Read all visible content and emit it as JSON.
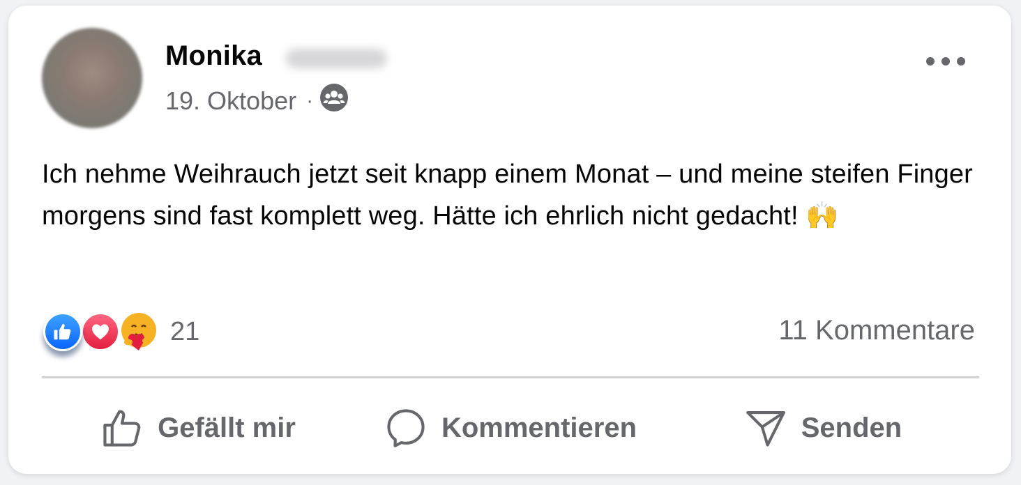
{
  "post": {
    "author_name": "Monika",
    "date": "19. Oktober",
    "separator": "·",
    "audience_icon": "group-icon",
    "text": "Ich nehme Weihrauch jetzt seit knapp einem Monat – und meine steifen Finger morgens sind fast komplett weg. Hätte ich ehrlich nicht gedacht! 🙌",
    "more_icon": "more-horizontal-icon"
  },
  "stats": {
    "reactions": [
      "like",
      "love",
      "care"
    ],
    "reaction_count": "21",
    "comments": "11 Kommentare"
  },
  "actions": {
    "like_label": "Gefällt mir",
    "comment_label": "Kommentieren",
    "share_label": "Senden"
  },
  "colors": {
    "text_primary": "#050505",
    "text_secondary": "#65676b",
    "like_blue": "#0866ff",
    "love_red": "#e41e3f",
    "divider": "#ced0d4"
  }
}
